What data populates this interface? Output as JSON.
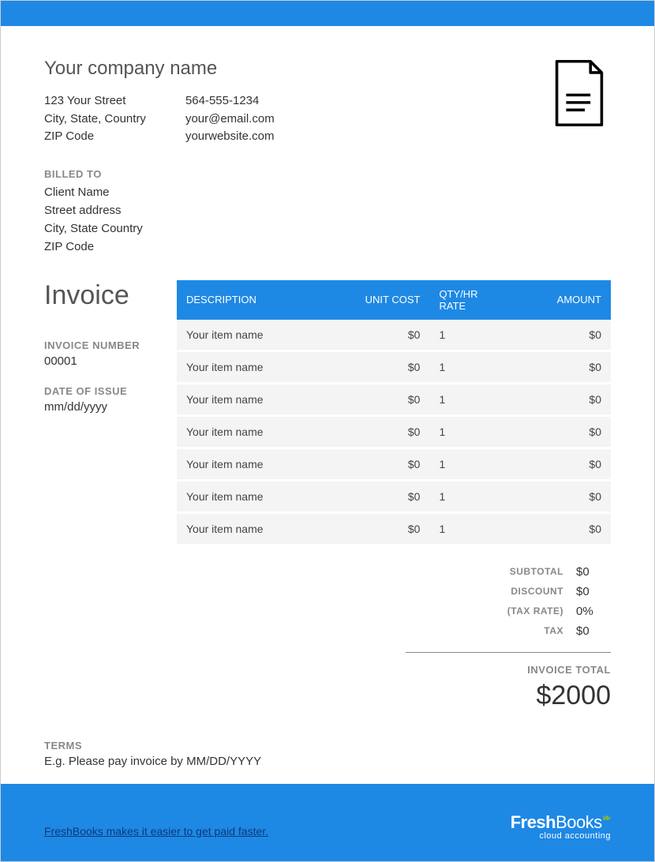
{
  "company": {
    "name": "Your company name",
    "address": {
      "street": "123 Your Street",
      "city": "City, State, Country",
      "zip": "ZIP Code"
    },
    "contact": {
      "phone": "564-555-1234",
      "email": "your@email.com",
      "website": "yourwebsite.com"
    }
  },
  "billed_to": {
    "label": "BILLED TO",
    "name": "Client Name",
    "street": "Street address",
    "city": "City, State Country",
    "zip": "ZIP Code"
  },
  "invoice": {
    "title": "Invoice",
    "number_label": "INVOICE NUMBER",
    "number": "00001",
    "date_label": "DATE OF ISSUE",
    "date": "mm/dd/yyyy"
  },
  "table": {
    "headers": {
      "description": "DESCRIPTION",
      "unit_cost": "UNIT COST",
      "qty": "QTY/HR RATE",
      "amount": "AMOUNT"
    },
    "rows": [
      {
        "desc": "Your item name",
        "unit": "$0",
        "qty": "1",
        "amount": "$0"
      },
      {
        "desc": "Your item name",
        "unit": "$0",
        "qty": "1",
        "amount": "$0"
      },
      {
        "desc": "Your item name",
        "unit": "$0",
        "qty": "1",
        "amount": "$0"
      },
      {
        "desc": "Your item name",
        "unit": "$0",
        "qty": "1",
        "amount": "$0"
      },
      {
        "desc": "Your item name",
        "unit": "$0",
        "qty": "1",
        "amount": "$0"
      },
      {
        "desc": "Your item name",
        "unit": "$0",
        "qty": "1",
        "amount": "$0"
      },
      {
        "desc": "Your item name",
        "unit": "$0",
        "qty": "1",
        "amount": "$0"
      }
    ]
  },
  "totals": {
    "subtotal_label": "SUBTOTAL",
    "subtotal": "$0",
    "discount_label": "DISCOUNT",
    "discount": "$0",
    "taxrate_label": "(TAX RATE)",
    "taxrate": "0%",
    "tax_label": "TAX",
    "tax": "$0",
    "total_label": "INVOICE TOTAL",
    "total": "$2000"
  },
  "terms": {
    "label": "TERMS",
    "text": "E.g. Please pay invoice by MM/DD/YYYY"
  },
  "footer": {
    "link_text": "FreshBooks makes it easier to get paid faster.",
    "brand_bold": "Fresh",
    "brand_thin": "Books",
    "tagline": "cloud accounting"
  }
}
